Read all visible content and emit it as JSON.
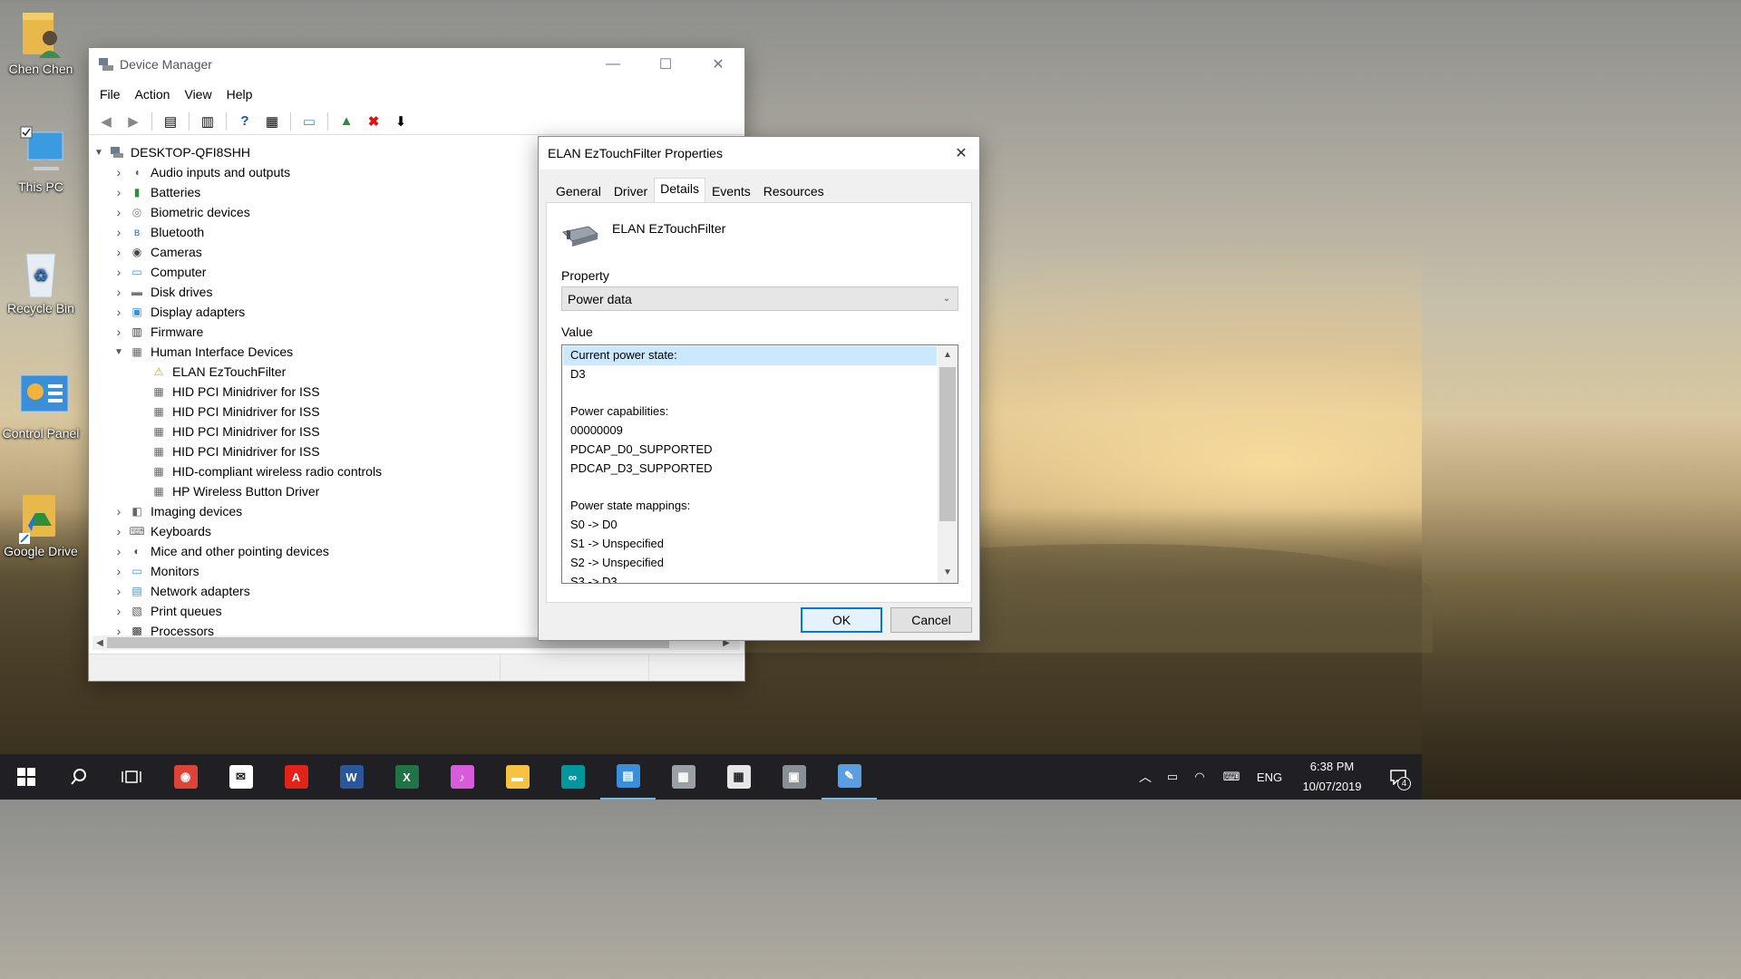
{
  "desktop": {
    "icons": [
      {
        "label": "Chen Chen"
      },
      {
        "label": "This PC"
      },
      {
        "label": "Recycle Bin"
      },
      {
        "label": "Control Panel"
      },
      {
        "label": "Google Drive"
      }
    ]
  },
  "device_manager": {
    "title": "Device Manager",
    "menu": [
      "File",
      "Action",
      "View",
      "Help"
    ],
    "root": "DESKTOP-QFI8SHH",
    "tree": [
      {
        "label": "Audio inputs and outputs",
        "icon": "speaker-icon",
        "expanded": false
      },
      {
        "label": "Batteries",
        "icon": "battery-icon",
        "expanded": false
      },
      {
        "label": "Biometric devices",
        "icon": "fingerprint-icon",
        "expanded": false
      },
      {
        "label": "Bluetooth",
        "icon": "bluetooth-icon",
        "expanded": false
      },
      {
        "label": "Cameras",
        "icon": "camera-icon",
        "expanded": false
      },
      {
        "label": "Computer",
        "icon": "computer-icon",
        "expanded": false
      },
      {
        "label": "Disk drives",
        "icon": "disk-icon",
        "expanded": false
      },
      {
        "label": "Display adapters",
        "icon": "display-adapter-icon",
        "expanded": false
      },
      {
        "label": "Firmware",
        "icon": "firmware-icon",
        "expanded": false
      },
      {
        "label": "Human Interface Devices",
        "icon": "hid-icon",
        "expanded": true,
        "children": [
          {
            "label": "ELAN EzTouchFilter",
            "icon": "warning-device-icon"
          },
          {
            "label": "HID PCI Minidriver for ISS",
            "icon": "hid-icon"
          },
          {
            "label": "HID PCI Minidriver for ISS",
            "icon": "hid-icon"
          },
          {
            "label": "HID PCI Minidriver for ISS",
            "icon": "hid-icon"
          },
          {
            "label": "HID PCI Minidriver for ISS",
            "icon": "hid-icon"
          },
          {
            "label": "HID-compliant wireless radio controls",
            "icon": "hid-icon"
          },
          {
            "label": "HP Wireless Button Driver",
            "icon": "hid-icon"
          }
        ]
      },
      {
        "label": "Imaging devices",
        "icon": "imaging-icon",
        "expanded": false
      },
      {
        "label": "Keyboards",
        "icon": "keyboard-icon",
        "expanded": false
      },
      {
        "label": "Mice and other pointing devices",
        "icon": "mouse-icon",
        "expanded": false
      },
      {
        "label": "Monitors",
        "icon": "monitor-icon",
        "expanded": false
      },
      {
        "label": "Network adapters",
        "icon": "network-icon",
        "expanded": false
      },
      {
        "label": "Print queues",
        "icon": "printer-icon",
        "expanded": false
      },
      {
        "label": "Processors",
        "icon": "processor-icon",
        "expanded": false
      }
    ]
  },
  "properties": {
    "title": "ELAN EzTouchFilter Properties",
    "tabs": [
      "General",
      "Driver",
      "Details",
      "Events",
      "Resources"
    ],
    "active_tab": "Details",
    "device_name": "ELAN EzTouchFilter",
    "property_label": "Property",
    "property_value": "Power data",
    "value_label": "Value",
    "values": [
      "Current power state:",
      "D3",
      "",
      "Power capabilities:",
      "00000009",
      "PDCAP_D0_SUPPORTED",
      "PDCAP_D3_SUPPORTED",
      "",
      "Power state mappings:",
      "S0 -> D0",
      "S1 -> Unspecified",
      "S2 -> Unspecified",
      "S3 -> D3"
    ],
    "ok_label": "OK",
    "cancel_label": "Cancel"
  },
  "taskbar": {
    "apps": [
      {
        "name": "chrome-icon",
        "color": "#db4437",
        "glyph": "◉"
      },
      {
        "name": "mail-icon",
        "color": "#ffffff",
        "glyph": "✉"
      },
      {
        "name": "acrobat-icon",
        "color": "#e2231a",
        "glyph": "A"
      },
      {
        "name": "word-icon",
        "color": "#2b579a",
        "glyph": "W"
      },
      {
        "name": "excel-icon",
        "color": "#217346",
        "glyph": "X"
      },
      {
        "name": "itunes-icon",
        "color": "#d85cd9",
        "glyph": "♪"
      },
      {
        "name": "file-explorer-icon",
        "color": "#f5c242",
        "glyph": "▬"
      },
      {
        "name": "arduino-icon",
        "color": "#00979d",
        "glyph": "∞"
      },
      {
        "name": "control-panel-icon",
        "color": "#3a8fd8",
        "glyph": "▤"
      },
      {
        "name": "scanner-icon",
        "color": "#9aa0a6",
        "glyph": "▦"
      },
      {
        "name": "calculator-icon",
        "color": "#e6e6e6",
        "glyph": "▦"
      },
      {
        "name": "device-manager-icon",
        "color": "#8a8f96",
        "glyph": "▣"
      },
      {
        "name": "paint-icon",
        "color": "#5aa0e0",
        "glyph": "✎"
      }
    ],
    "language": "ENG",
    "time": "6:38 PM",
    "date": "10/07/2019",
    "notification_count": "4"
  }
}
